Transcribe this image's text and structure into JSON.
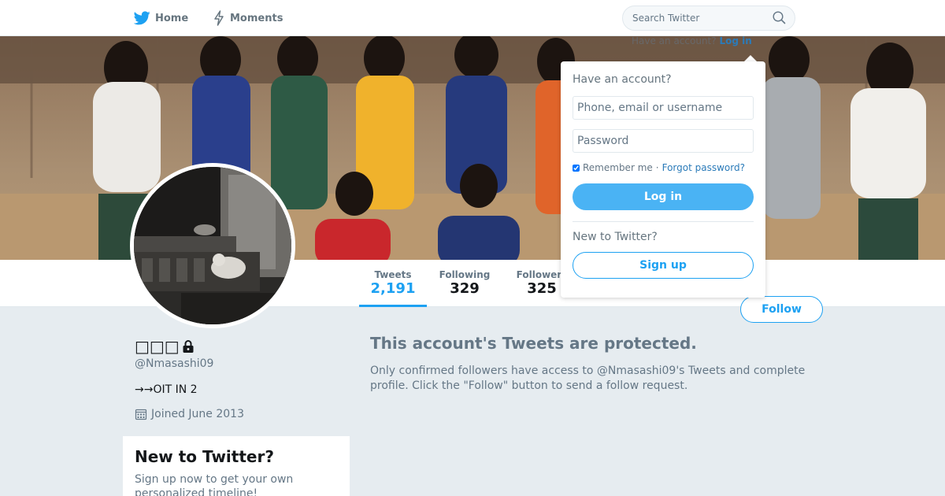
{
  "nav": {
    "home_label": "Home",
    "moments_label": "Moments",
    "search_placeholder": "Search Twitter"
  },
  "login_hint": {
    "prefix": "Have an account?",
    "login_label": "Log in"
  },
  "profile_nav": {
    "stats": [
      {
        "label": "Tweets",
        "value": "2,191"
      },
      {
        "label": "Following",
        "value": "329"
      },
      {
        "label": "Followers",
        "value": "325"
      }
    ],
    "follow_label": "Follow"
  },
  "profile": {
    "name": "□□□",
    "handle": "@Nmasashi09",
    "bio": "→→OIT IN 2",
    "joined": "Joined June 2013"
  },
  "signup_card": {
    "title": "New to Twitter?",
    "text": "Sign up now to get your own personalized timeline!"
  },
  "protected": {
    "title": "This account's Tweets are protected.",
    "text": "Only confirmed followers have access to @Nmasashi09's Tweets and complete profile. Click the \"Follow\" button to send a follow request."
  },
  "login_dropdown": {
    "heading": "Have an account?",
    "username_placeholder": "Phone, email or username",
    "password_placeholder": "Password",
    "remember_label": "Remember me",
    "separator": "·",
    "forgot_label": "Forgot password?",
    "login_button": "Log in",
    "new_heading": "New to Twitter?",
    "signup_button": "Sign up"
  },
  "colors": {
    "brand": "#1da1f2",
    "background": "#e6ecf0",
    "muted_text": "#657786",
    "login_button": "#4ab3f4"
  },
  "icons": [
    "twitter-bird-icon",
    "moments-bolt-icon",
    "search-icon",
    "lock-icon",
    "calendar-icon"
  ]
}
